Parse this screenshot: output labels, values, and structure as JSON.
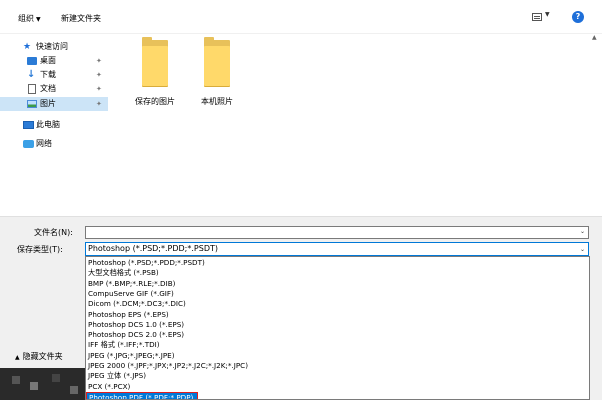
{
  "toolbar": {
    "organize_label": "组织",
    "organize_arrow": "▼",
    "new_folder_label": "新建文件夹",
    "view_icon": "view-options-icon",
    "help_label": "?"
  },
  "nav": {
    "items": [
      {
        "label": "快速访问",
        "icon": "star-icon",
        "pinned": false
      },
      {
        "label": "桌面",
        "icon": "desktop-icon",
        "pinned": true
      },
      {
        "label": "下载",
        "icon": "download-icon",
        "pinned": true
      },
      {
        "label": "文档",
        "icon": "document-icon",
        "pinned": true
      },
      {
        "label": "图片",
        "icon": "pictures-icon",
        "pinned": true
      },
      {
        "label": "此电脑",
        "icon": "computer-icon",
        "pinned": false
      },
      {
        "label": "网络",
        "icon": "network-icon",
        "pinned": false
      }
    ]
  },
  "folders": [
    {
      "name": "保存的图片"
    },
    {
      "name": "本机照片"
    }
  ],
  "form": {
    "filename_label": "文件名(N):",
    "filename_value": "",
    "savetype_label": "保存类型(T):",
    "savetype_value": "Photoshop (*.PSD;*.PDD;*.PSDT)",
    "dropdown_arrow": "⌄"
  },
  "hide_folders": "隐藏文件夹",
  "filetypes": [
    "Photoshop (*.PSD;*.PDD;*.PSDT)",
    "大型文档格式 (*.PSB)",
    "BMP (*.BMP;*.RLE;*.DIB)",
    "CompuServe GIF (*.GIF)",
    "Dicom (*.DCM;*.DC3;*.DIC)",
    "Photoshop EPS (*.EPS)",
    "Photoshop DCS 1.0 (*.EPS)",
    "Photoshop DCS 2.0 (*.EPS)",
    "IFF 格式 (*.IFF;*.TDI)",
    "JPEG (*.JPG;*.JPEG;*.JPE)",
    "JPEG 2000 (*.JPF;*.JPX;*.JP2;*.J2C;*.J2K;*.JPC)",
    "JPEG 立体 (*.JPS)",
    "PCX (*.PCX)",
    "Photoshop PDF (*.PDF;*.PDP)"
  ],
  "colors": {
    "accent": "#0078d7",
    "highlight_border": "#e21d1d",
    "folder": "#ffd96a"
  }
}
